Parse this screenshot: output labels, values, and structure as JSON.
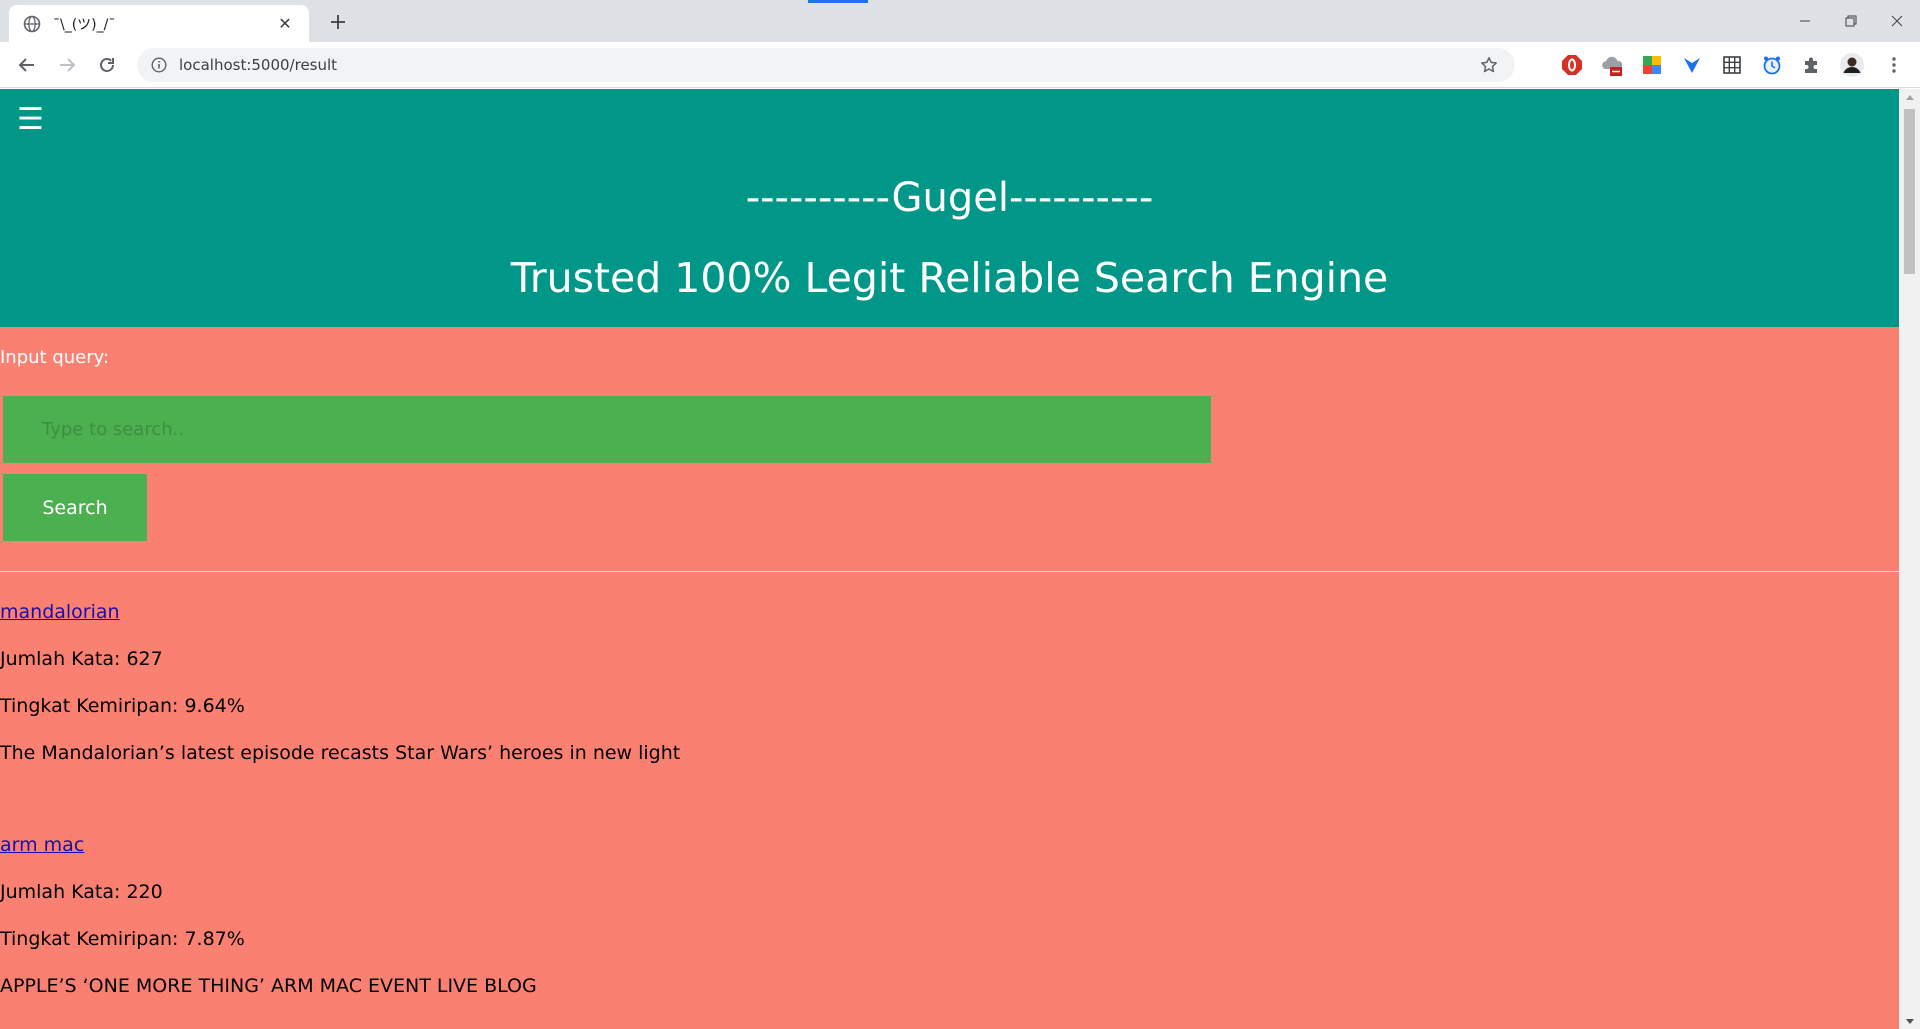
{
  "browser": {
    "tab_title": "¯\\_(ツ)_/¯",
    "url": "localhost:5000/result",
    "icons": {
      "tab": "globe-icon",
      "back": "back-arrow-icon",
      "forward": "forward-arrow-icon",
      "reload": "reload-icon",
      "info": "info-icon",
      "bookmark": "star-icon",
      "extensions": [
        "opera-stop-icon",
        "cloud-extension-icon",
        "colorful-extension-icon",
        "bird-extension-icon",
        "grid-extension-icon",
        "clock-extension-icon",
        "puzzle-icon",
        "profile-avatar",
        "kebab-menu-icon"
      ]
    }
  },
  "header": {
    "menu_icon": "hamburger-menu-icon",
    "title": "----------Gugel----------",
    "subtitle": "Trusted 100% Legit Reliable Search Engine"
  },
  "search": {
    "label": "Input query:",
    "placeholder": "Type to search..",
    "value": "",
    "button_label": "Search"
  },
  "results": [
    {
      "title": "mandalorian",
      "word_count": "Jumlah Kata: 627",
      "similarity": "Tingkat Kemiripan: 9.64%",
      "snippet": "The Mandalorian’s latest episode recasts Star Wars’ heroes in new light"
    },
    {
      "title": "arm mac",
      "word_count": "Jumlah Kata: 220",
      "similarity": "Tingkat Kemiripan: 7.87%",
      "snippet": "APPLE’S ‘ONE MORE THING’ ARM MAC EVENT LIVE BLOG"
    }
  ],
  "colors": {
    "header_bg": "#009688",
    "page_bg": "#fa8072",
    "input_bg": "#4caf50",
    "link": "#1a0dab"
  }
}
